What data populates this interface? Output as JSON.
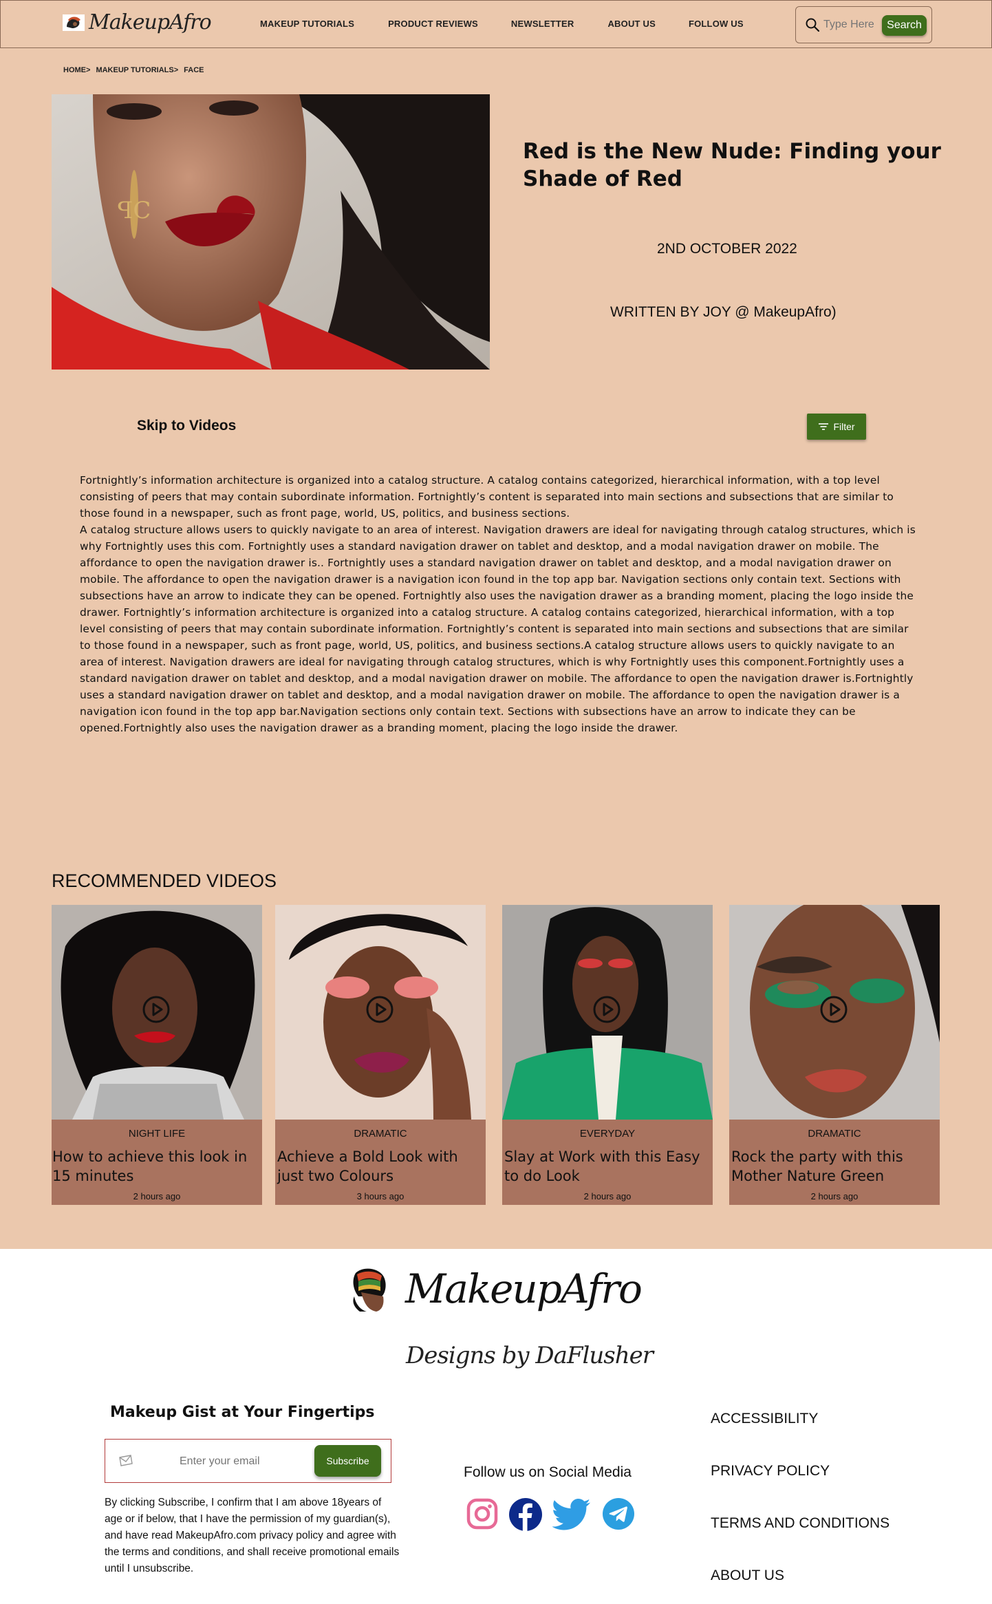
{
  "header": {
    "logo_text": "MakeupAfro",
    "nav": [
      "MAKEUP TUTORIALS",
      "PRODUCT REVIEWS",
      "NEWSLETTER",
      "ABOUT US",
      "FOLLOW US"
    ],
    "search_placeholder": "Type Here",
    "search_button": "Search"
  },
  "breadcrumb": [
    "HOME>",
    "MAKEUP TUTORIALS>",
    "FACE"
  ],
  "article": {
    "title": "Red is the New Nude: Finding your Shade of Red",
    "date": "2ND OCTOBER 2022",
    "author": "WRITTEN BY JOY @  MakeupAfro)",
    "skip_link": "Skip to Videos",
    "filter_button": "Filter",
    "body": "Fortnightly’s information architecture is organized into a catalog structure. A catalog contains categorized, hierarchical information, with a top level consisting of peers that may contain subordinate information. Fortnightly’s content is separated into main sections and subsections that are similar to those found in a newspaper, such as front page, world, US, politics, and business sections.\n A catalog structure allows users to quickly navigate to an area of interest. Navigation drawers are ideal for navigating through catalog structures, which is why Fortnightly uses this com. Fortnightly uses a standard navigation drawer on tablet and desktop, and a modal navigation drawer on mobile. The affordance to open the navigation drawer is.. Fortnightly uses a standard navigation drawer on tablet and desktop, and a modal navigation drawer on mobile. The affordance to open the navigation drawer is a navigation icon found in the top app bar. Navigation sections only contain text. Sections with subsections have an arrow to indicate they can be opened. Fortnightly also uses the navigation drawer as a branding moment, placing the logo inside the drawer. Fortnightly’s information architecture is organized into a catalog structure. A catalog contains categorized, hierarchical information, with a top level consisting of peers that may contain subordinate information. Fortnightly’s content is separated into main sections and subsections that are similar to those found in a newspaper, such as front page, world, US, politics, and business sections.A catalog structure allows users to quickly navigate to an area of interest. Navigation drawers are ideal for navigating through catalog structures, which is why Fortnightly uses this component.Fortnightly uses a standard navigation drawer on tablet and desktop, and a modal navigation drawer on mobile. The affordance to open the navigation drawer is.Fortnightly uses a standard navigation drawer on tablet and desktop, and a modal navigation drawer on mobile. The affordance to open the navigation drawer is a navigation icon found in the top app bar.Navigation sections only contain text. Sections with subsections have an arrow to indicate they can be opened.Fortnightly also uses the navigation drawer as a branding moment, placing the logo inside the drawer."
  },
  "recommended": {
    "heading": "RECOMMENDED VIDEOS",
    "cards": [
      {
        "category": "NIGHT LIFE",
        "title": "How to achieve this look in 15 minutes",
        "time": "2 hours ago"
      },
      {
        "category": "DRAMATIC",
        "title": "Achieve a Bold Look with just two Colours",
        "time": "3 hours ago"
      },
      {
        "category": "EVERYDAY",
        "title": "Slay at Work with this Easy to do Look",
        "time": "2 hours ago"
      },
      {
        "category": "DRAMATIC",
        "title": "Rock the party with this Mother Nature Green",
        "time": "2 hours ago"
      }
    ]
  },
  "footer": {
    "logo_text": "MakeupAfro",
    "tagline": "Designs by DaFlusher",
    "newsletter_heading": "Makeup Gist at Your Fingertips",
    "email_placeholder": "Enter your email",
    "subscribe_button": "Subscribe",
    "consent": "By clicking Subscribe, I confirm that I am above 18years of age or if below, that I have the permission of my guardian(s), and have read MakeupAfro.com privacy policy and agree with the terms and conditions, and shall receive promotional emails until I unsubscribe.",
    "follow_heading": "Follow us on Social Media",
    "social_icons": [
      "instagram-icon",
      "facebook-icon",
      "twitter-icon",
      "telegram-icon"
    ],
    "links": [
      "ACCESSIBILITY",
      "PRIVACY POLICY",
      "TERMS AND CONDITIONS",
      "ABOUT US"
    ]
  },
  "colors": {
    "page_bg": "#ebc8ad",
    "card_info_bg": "#a9735f",
    "button_green": "#3f6e1c",
    "header_border": "#8a6a55"
  }
}
